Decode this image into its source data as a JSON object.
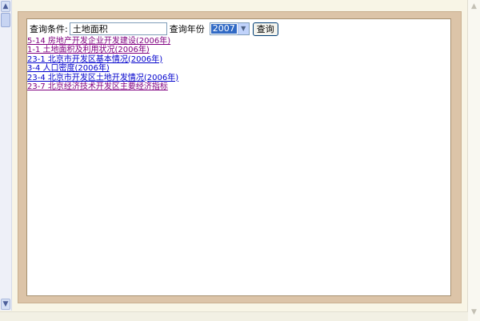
{
  "search": {
    "condition_label": "查询条件:",
    "condition_value": "土地面积",
    "year_label": "查询年份",
    "year_value": "2007",
    "button_label": "查询"
  },
  "results": [
    {
      "text": "5-14 房地产开发企业开发建设(2006年)",
      "visited": true
    },
    {
      "text": "1-1 土地面积及利用状况(2006年)",
      "visited": true
    },
    {
      "text": "23-1 北京市开发区基本情况(2006年)",
      "visited": false
    },
    {
      "text": "3-4 人口密度(2006年)",
      "visited": false
    },
    {
      "text": "23-4 北京市开发区土地开发情况(2006年)",
      "visited": false
    },
    {
      "text": "23-7 北京经济技术开发区主要经济指标",
      "visited": true
    }
  ],
  "icons": {
    "scroll_up": "arrow-up-icon",
    "scroll_down": "arrow-down-icon",
    "dropdown": "chevron-down-icon"
  },
  "colors": {
    "frame": "#dcc4a8",
    "link": "#0000cc",
    "visited_link": "#800080",
    "selection": "#316ac5"
  }
}
